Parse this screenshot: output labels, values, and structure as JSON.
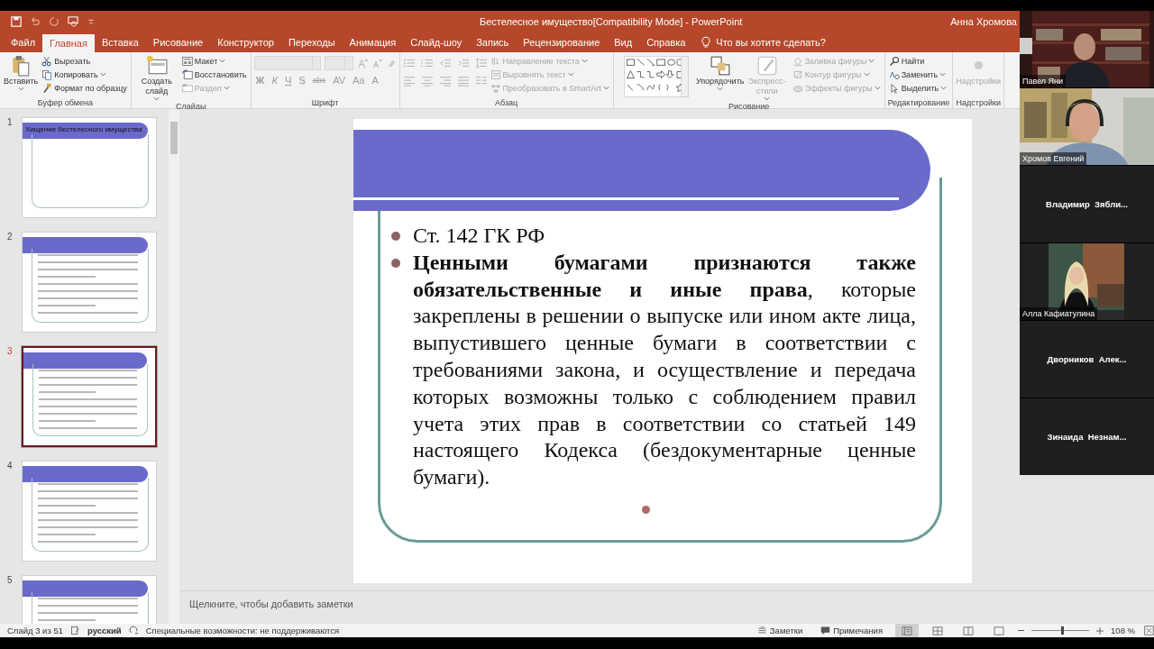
{
  "window": {
    "title": "Бестелесное имущество[Compatibility Mode]  -  PowerPoint",
    "user": "Анна Хромова"
  },
  "tabs": [
    {
      "label": "Файл",
      "selected": false
    },
    {
      "label": "Главная",
      "selected": true
    },
    {
      "label": "Вставка",
      "selected": false
    },
    {
      "label": "Рисование",
      "selected": false
    },
    {
      "label": "Конструктор",
      "selected": false
    },
    {
      "label": "Переходы",
      "selected": false
    },
    {
      "label": "Анимация",
      "selected": false
    },
    {
      "label": "Слайд-шоу",
      "selected": false
    },
    {
      "label": "Запись",
      "selected": false
    },
    {
      "label": "Рецензирование",
      "selected": false
    },
    {
      "label": "Вид",
      "selected": false
    },
    {
      "label": "Справка",
      "selected": false
    }
  ],
  "tell_me": "Что вы хотите сделать?",
  "ribbon": {
    "groups": [
      {
        "label": "Буфер обмена",
        "kind": "plain",
        "items": [
          {
            "label": "Вставить",
            "kind": "large",
            "disabled": false,
            "dropdown": true
          },
          {
            "label": "Вырезать",
            "kind": "small",
            "disabled": false,
            "dropdown": false
          },
          {
            "label": "Копировать",
            "kind": "small",
            "disabled": false,
            "dropdown": true
          },
          {
            "label": "Формат по образцу",
            "kind": "small",
            "disabled": false,
            "dropdown": false
          }
        ]
      },
      {
        "label": "Слайды",
        "kind": "plain",
        "items": [
          {
            "label": "Создать слайд",
            "kind": "large",
            "disabled": false,
            "dropdown": true
          },
          {
            "label": "Макет",
            "kind": "small",
            "disabled": false,
            "dropdown": true
          },
          {
            "label": "Восстановить",
            "kind": "small",
            "disabled": false,
            "dropdown": false
          },
          {
            "label": "Раздел",
            "kind": "small",
            "disabled": true,
            "dropdown": true
          }
        ]
      },
      {
        "label": "Шрифт",
        "kind": "font",
        "items": [
          {
            "label": "Ж",
            "kind": "glyph",
            "disabled": true
          },
          {
            "label": "К",
            "kind": "glyph",
            "disabled": true
          },
          {
            "label": "Ч",
            "kind": "glyph",
            "disabled": true
          },
          {
            "label": "S",
            "kind": "glyph",
            "disabled": true
          },
          {
            "label": "abc",
            "kind": "glyph",
            "disabled": true
          },
          {
            "label": "AV",
            "kind": "glyph",
            "disabled": true
          },
          {
            "label": "Aa",
            "kind": "glyph",
            "disabled": true
          },
          {
            "label": "A",
            "kind": "glyph",
            "disabled": true
          }
        ]
      },
      {
        "label": "Абзац",
        "kind": "paragraph",
        "items": [
          {
            "label": "Направление текста",
            "kind": "small",
            "disabled": true,
            "dropdown": true
          },
          {
            "label": "Выровнять текст",
            "kind": "small",
            "disabled": true,
            "dropdown": true
          },
          {
            "label": "Преобразовать в SmartArt",
            "kind": "small",
            "disabled": true,
            "dropdown": true
          }
        ]
      },
      {
        "label": "Рисование",
        "kind": "drawing",
        "items": [
          {
            "label": "Упорядочить",
            "kind": "large",
            "disabled": false,
            "dropdown": true
          },
          {
            "label": "Экспресс-стили",
            "kind": "large",
            "disabled": true,
            "dropdown": true
          },
          {
            "label": "Заливка фигуры",
            "kind": "small",
            "disabled": true,
            "dropdown": true
          },
          {
            "label": "Контур фигуры",
            "kind": "small",
            "disabled": true,
            "dropdown": true
          },
          {
            "label": "Эффекты фигуры",
            "kind": "small",
            "disabled": true,
            "dropdown": true
          }
        ]
      },
      {
        "label": "Редактирование",
        "kind": "plain",
        "items": [
          {
            "label": "Найти",
            "kind": "small",
            "disabled": false,
            "dropdown": false
          },
          {
            "label": "Заменить",
            "kind": "small",
            "disabled": false,
            "dropdown": true
          },
          {
            "label": "Выделить",
            "kind": "small",
            "disabled": false,
            "dropdown": true
          }
        ]
      },
      {
        "label": "Надстройки",
        "kind": "plain",
        "items": [
          {
            "label": "Надстройки",
            "kind": "large",
            "disabled": true,
            "dropdown": false
          }
        ]
      }
    ]
  },
  "thumbnails": [
    {
      "number": "1",
      "selected": false,
      "title": "Хищение бестелесного имущества"
    },
    {
      "number": "2",
      "selected": false
    },
    {
      "number": "3",
      "selected": true
    },
    {
      "number": "4",
      "selected": false
    },
    {
      "number": "5",
      "selected": false
    }
  ],
  "slide": {
    "bullets": [
      "Ст. 142 ГК РФ",
      "**Ценными бумагами признаются также обязательственные и иные права**, которые закреплены в решении о выпуске или ином акте лица, выпустившего ценные бумаги в соответствии с требованиями закона, и осуществление и передача которых возможны только с соблюдением правил учета этих прав в соответствии со статьей 149 настоящего Кодекса (бездокументарные ценные бумаги)."
    ]
  },
  "notes_placeholder": "Щелкните, чтобы добавить заметки",
  "status_bar": {
    "slide_info": "Слайд 3 из 51",
    "language": "русский",
    "accessibility": "Специальные возможности: не поддерживаются",
    "notes": "Заметки",
    "comments": "Примечания",
    "views": [
      {
        "selected": true
      },
      {
        "selected": false
      },
      {
        "selected": false
      },
      {
        "selected": false
      }
    ],
    "zoom": {
      "level": 0.52,
      "reading": "108 %"
    }
  },
  "participants": [
    {
      "name": "Павел Яни",
      "kind": "video"
    },
    {
      "name": "Хромов Евгений",
      "kind": "video"
    },
    {
      "name": "Владимир  Зябли...",
      "kind": "camera_off"
    },
    {
      "name": "Алла Кафиатулина",
      "kind": "video"
    },
    {
      "name": "Дворников  Алек...",
      "kind": "camera_off"
    },
    {
      "name": "Зинаида  Незнам...",
      "kind": "camera_off"
    }
  ]
}
